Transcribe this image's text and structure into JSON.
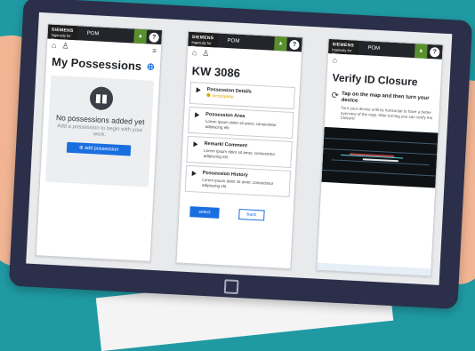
{
  "header": {
    "brand_name": "SIEMENS",
    "brand_tagline": "Ingenuity for life",
    "app_tab": "POM",
    "help_label": "?"
  },
  "screen1": {
    "title": "My Possessions",
    "empty_title": "No possessions added yet",
    "empty_subtitle": "Add a possession to begin with your work.",
    "add_button": "add possession"
  },
  "screen2": {
    "title": "KW 3086",
    "sections": [
      {
        "title": "Possession Details",
        "status": "Incomplete",
        "desc": ""
      },
      {
        "title": "Possession Area",
        "status": "",
        "desc": "Lorem ipsum dolor sit amet, consectetur adipiscing elit."
      },
      {
        "title": "Remark/ Comment",
        "status": "",
        "desc": "Lorem ipsum dolor sit amet, consectetur adipiscing elit."
      },
      {
        "title": "Possession History",
        "status": "",
        "desc": "Lorem ipsum dolor sit amet, consectetur adipiscing elit."
      }
    ],
    "select_button": "select",
    "back_button": "back"
  },
  "screen3": {
    "title": "Verify ID Closure",
    "instruction_title": "Tap on the map and then turn your device",
    "instruction_desc": "Turn your device until its horizontal to have a better overview of the map. After turning you can verify the Closure!"
  },
  "colors": {
    "background": "#1f9aa3",
    "tablet": "#2b2f4a",
    "accent": "#1a6fe0",
    "warning": "#e0a500"
  }
}
